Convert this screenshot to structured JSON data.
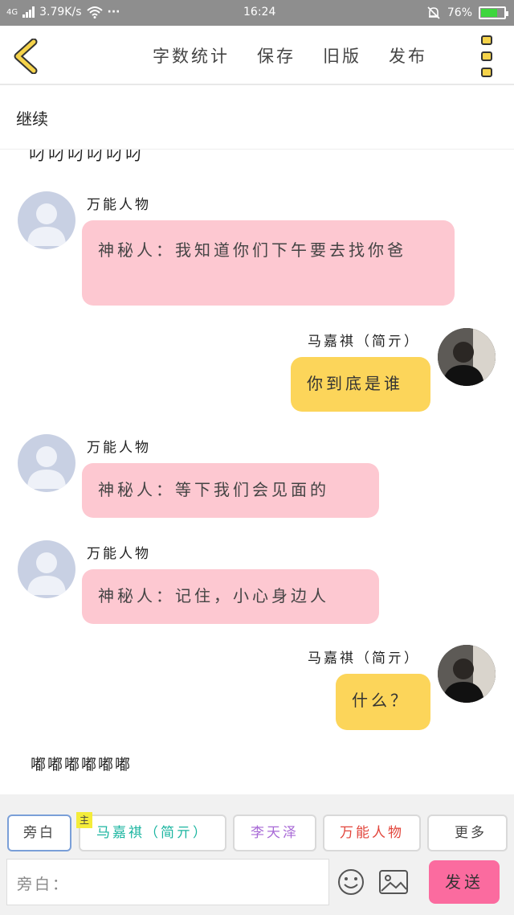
{
  "status_bar": {
    "network": "4G",
    "speed": "3.79K/s",
    "dots": "···",
    "time": "16:24",
    "battery_percent": "76%",
    "battery_level": 0.76
  },
  "toolbar": {
    "actions": [
      "字数统计",
      "保存",
      "旧版",
      "发布"
    ]
  },
  "continue_label": "继续",
  "chat": {
    "partial_text": "叼叼叼叼叼叼",
    "messages": [
      {
        "side": "left",
        "name": "万能人物",
        "text": "神秘人：我知道你们下午要去找你爸"
      },
      {
        "side": "right",
        "name": "马嘉祺（简亓）",
        "text": "你到底是谁"
      },
      {
        "side": "left",
        "name": "万能人物",
        "text": "神秘人：等下我们会见面的"
      },
      {
        "side": "left",
        "name": "万能人物",
        "text": "神秘人：记住，小心身边人"
      },
      {
        "side": "right",
        "name": "马嘉祺（简亓）",
        "text": "什么？"
      }
    ],
    "tail_text": "嘟嘟嘟嘟嘟嘟"
  },
  "bottom": {
    "tabs": [
      {
        "label": "旁白",
        "color": "#444444"
      },
      {
        "label": "马嘉祺（简亓）",
        "color": "#1bb5a0"
      },
      {
        "label": "李天泽",
        "color": "#a86ad6"
      },
      {
        "label": "万能人物",
        "color": "#e2463c"
      },
      {
        "label": "更多",
        "color": "#444444"
      }
    ],
    "main_badge": "主",
    "input_placeholder": "旁白：",
    "send_label": "发送"
  }
}
